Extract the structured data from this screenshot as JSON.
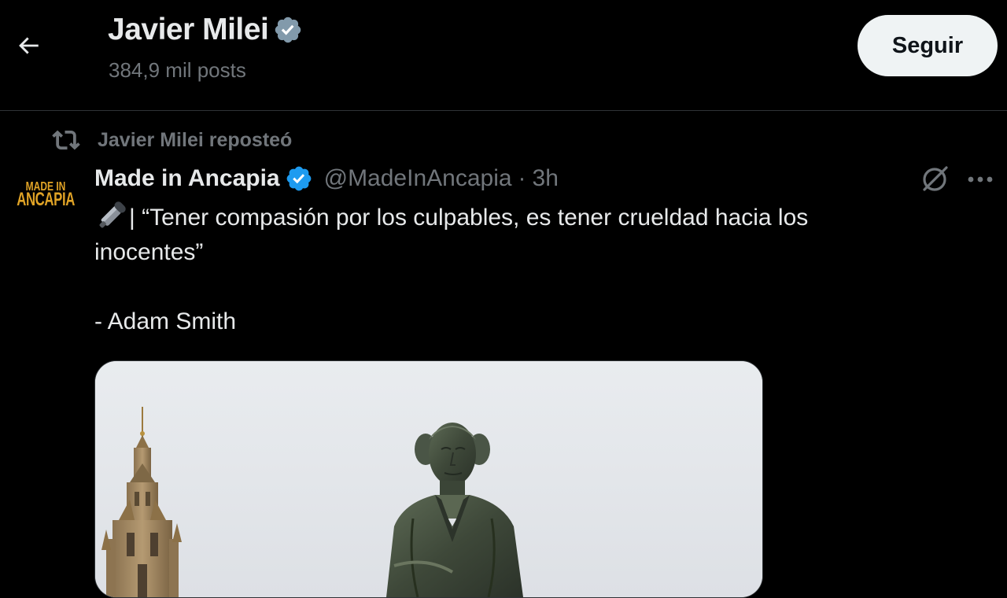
{
  "header": {
    "back_icon": "arrow-left-icon",
    "profile_name": "Javier Milei",
    "verified_icon": "verified-badge-gray-icon",
    "post_count": "384,9 mil posts",
    "follow_label": "Seguir"
  },
  "repost": {
    "icon": "repost-icon",
    "text": "Javier Milei reposteó"
  },
  "tweet": {
    "avatar_line1": "MADE IN",
    "avatar_line2": "ANCAPIA",
    "author_name": "Made in Ancapia",
    "verified_icon": "verified-badge-blue-icon",
    "handle": "@MadeInAncapia",
    "separator": "·",
    "time": "3h",
    "grok_icon": "grok-icon",
    "more_icon": "more-dots-icon",
    "text_line1": "| “Tener compasión por los culpables, es tener crueldad hacia los",
    "text_line2": "inocentes”",
    "text_line3": "- Adam Smith",
    "emoji": "microphone-emoji",
    "media": "statue-photo"
  },
  "colors": {
    "background": "#000000",
    "text_primary": "#e7e9ea",
    "text_secondary": "#71767b",
    "verified_blue": "#1d9bf0",
    "verified_gray": "#829aab",
    "follow_bg": "#eff3f4",
    "avatar_gold": "#e0a326"
  }
}
